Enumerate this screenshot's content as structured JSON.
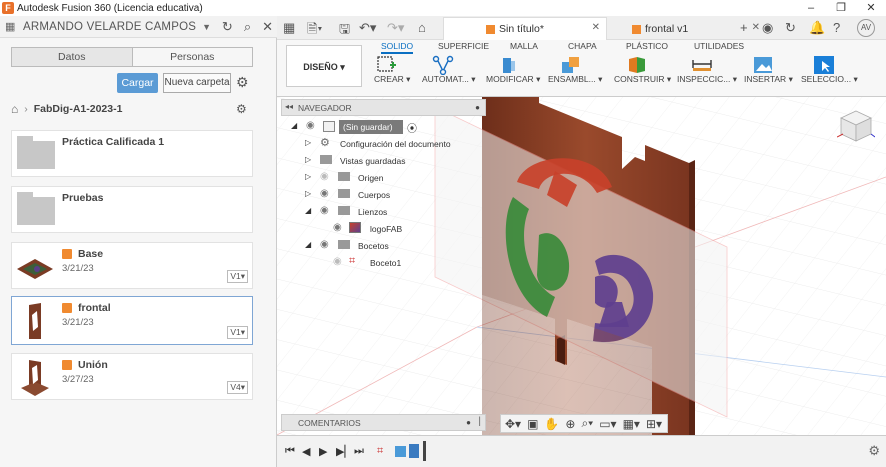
{
  "window": {
    "title": "Autodesk Fusion 360 (Licencia educativa)",
    "minimize": "–",
    "maximize": "❐",
    "close": "✕"
  },
  "left_header": {
    "user": "ARMANDO VELARDE CAMPOS"
  },
  "data_panel": {
    "tabs": [
      "Datos",
      "Personas"
    ],
    "upload_label": "Cargar",
    "new_folder_label": "Nueva carpeta",
    "breadcrumb": "FabDig-A1-2023-1",
    "items": [
      {
        "name": "Práctica Calificada 1",
        "type": "folder"
      },
      {
        "name": "Pruebas",
        "type": "folder"
      },
      {
        "name": "Base",
        "type": "design",
        "date": "3/21/23",
        "version": "V1"
      },
      {
        "name": "frontal",
        "type": "design",
        "date": "3/21/23",
        "version": "V1",
        "selected": true
      },
      {
        "name": "Unión",
        "type": "design",
        "date": "3/27/23",
        "version": "V4"
      }
    ]
  },
  "doc_tabs": {
    "active": "Sin título*",
    "other": "frontal v1",
    "user_initials": "AV"
  },
  "ribbon": {
    "workspace": "DISEÑO",
    "tabs": [
      "SOLIDO",
      "SUPERFICIE",
      "MALLA",
      "CHAPA",
      "PLÁSTICO",
      "UTILIDADES"
    ],
    "active_tab": "SOLIDO",
    "groups": [
      "CREAR",
      "AUTOMAT...",
      "MODIFICAR",
      "ENSAMBL...",
      "CONSTRUIR",
      "INSPECCIC...",
      "INSERTAR",
      "SELECCIO..."
    ]
  },
  "navigator": {
    "title": "NAVEGADOR",
    "root": "(Sin guardar)",
    "rows": [
      "Configuración del documento",
      "Vistas guardadas",
      "Origen",
      "Cuerpos",
      "Lienzos",
      "logoFAB",
      "Bocetos",
      "Boceto1"
    ]
  },
  "comments": {
    "title": "COMENTARIOS"
  },
  "colors": {
    "accent": "#0a6fc2",
    "upload_button": "#5b9bd5",
    "wood": "#8b3d26",
    "logo_red": "#c8412a",
    "logo_green": "#3a8a3a",
    "logo_purple": "#5e3f8e"
  }
}
